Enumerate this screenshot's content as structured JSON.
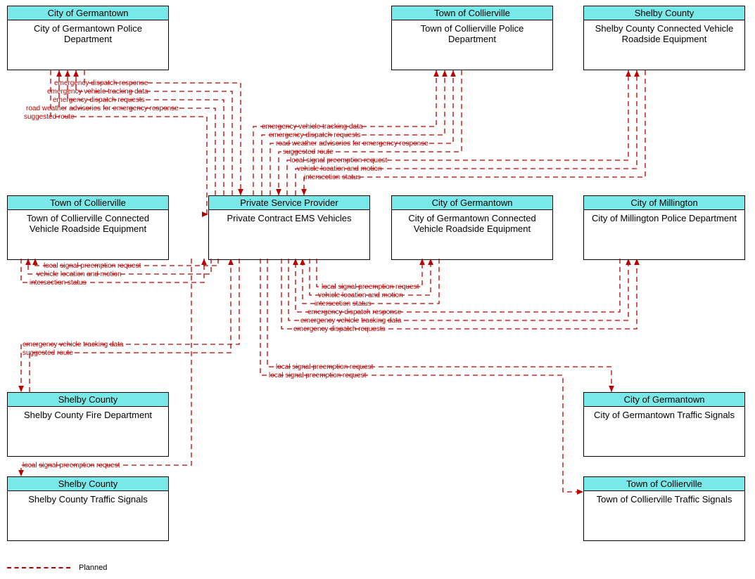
{
  "nodes": {
    "germantownPolice": {
      "header": "City of Germantown",
      "body": "City of Germantown Police Department"
    },
    "colliervillePolice": {
      "header": "Town of Collierville",
      "body": "Town of Collierville Police Department"
    },
    "shelbyCVRE": {
      "header": "Shelby County",
      "body": "Shelby County Connected Vehicle Roadside Equipment"
    },
    "collierCVRE": {
      "header": "Town of Collierville",
      "body": "Town of Collierville Connected Vehicle Roadside Equipment"
    },
    "privateEMS": {
      "header": "Private Service Provider",
      "body": "Private Contract EMS Vehicles"
    },
    "germantownCVRE": {
      "header": "City of Germantown",
      "body": "City of Germantown Connected Vehicle Roadside Equipment"
    },
    "millingtonPolice": {
      "header": "City of Millington",
      "body": "City of Millington Police Department"
    },
    "shelbyFire": {
      "header": "Shelby County",
      "body": "Shelby County Fire Department"
    },
    "germantownSignals": {
      "header": "City of Germantown",
      "body": "City of Germantown Traffic Signals"
    },
    "shelbySignals": {
      "header": "Shelby County",
      "body": "Shelby County Traffic Signals"
    },
    "collierSignals": {
      "header": "Town of Collierville",
      "body": "Town of Collierville Traffic Signals"
    }
  },
  "flows": {
    "gp1": "emergency dispatch response",
    "gp2": "emergency vehicle tracking data",
    "gp3": "emergency dispatch requests",
    "gp4": "road weather advisories for emergency response",
    "gp5": "suggested route",
    "cp1": "emergency vehicle tracking data",
    "cp2": "emergency dispatch requests",
    "cp3": "road weather advisories for emergency response",
    "cp4": "suggested route",
    "sc1": "local signal preemption request",
    "sc2": "vehicle location and motion",
    "sc3": "intersection status",
    "cc1": "local signal preemption request",
    "cc2": "vehicle location and motion",
    "cc3": "intersection status",
    "gc1": "local signal preemption request",
    "gc2": "vehicle location and motion",
    "gc3": "intersection status",
    "mp1": "emergency dispatch response",
    "mp2": "emergency vehicle tracking data",
    "mp3": "emergency dispatch requests",
    "sf1": "emergency vehicle tracking data",
    "sf2": "suggested route",
    "gs1": "local signal preemption request",
    "cs1": "local signal preemption request",
    "ss1": "local signal preemption request"
  },
  "legend": {
    "planned": "Planned"
  }
}
